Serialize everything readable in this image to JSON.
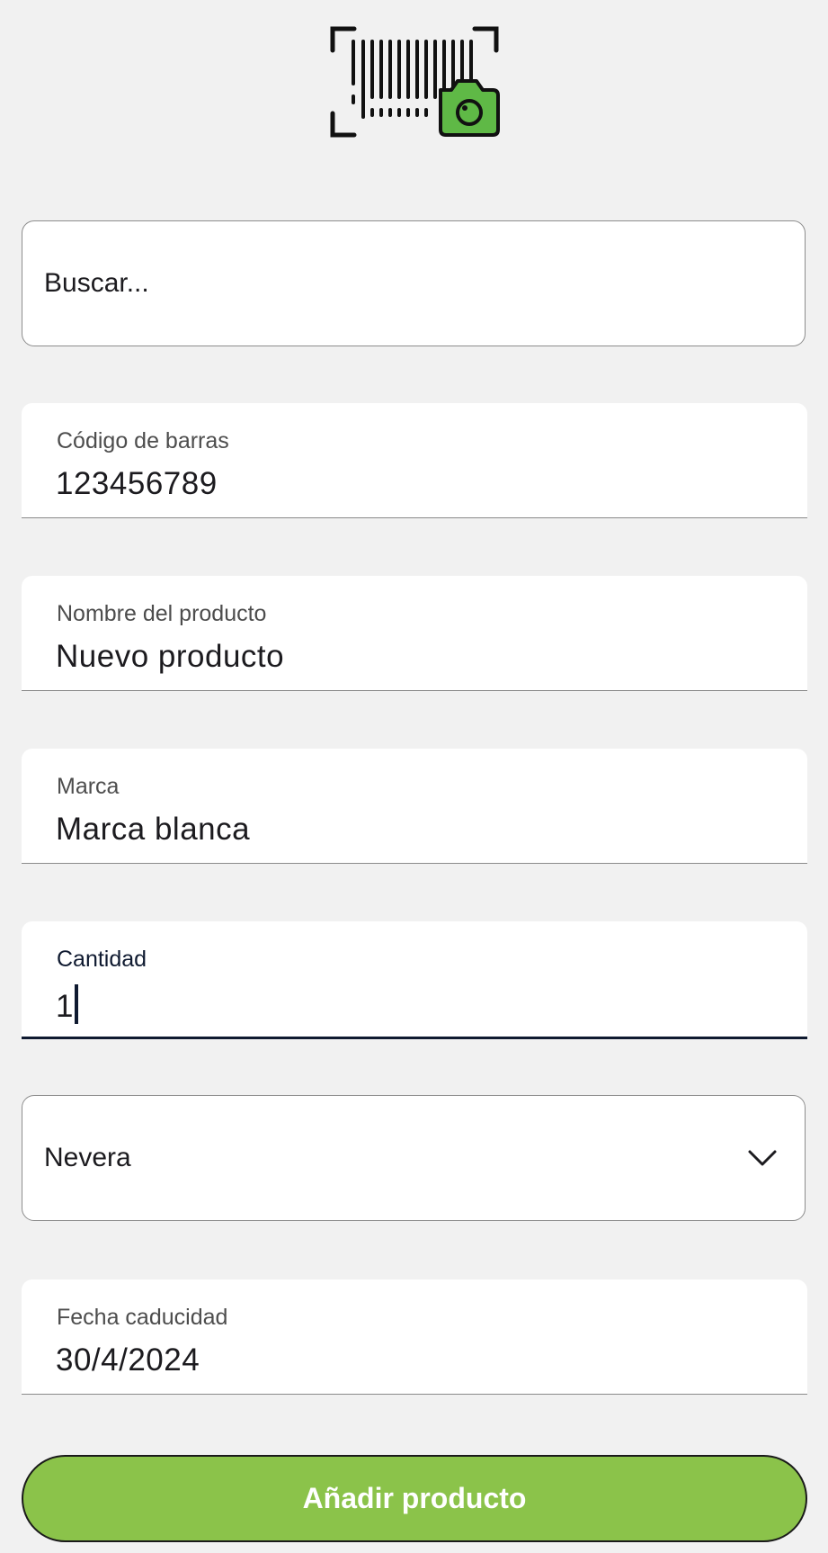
{
  "logo": {
    "icon": "barcode-scanner-camera-icon",
    "accent_color": "#5fb946"
  },
  "search": {
    "placeholder": "Buscar..."
  },
  "form": {
    "barcode": {
      "label": "Código de barras",
      "value": "123456789"
    },
    "product_name": {
      "label": "Nombre del producto",
      "value": "Nuevo producto"
    },
    "brand": {
      "label": "Marca",
      "value": "Marca blanca"
    },
    "quantity": {
      "label": "Cantidad",
      "value": "1"
    },
    "location": {
      "selected": "Nevera",
      "icon": "chevron-down-icon"
    },
    "expiry": {
      "label": "Fecha caducidad",
      "value": "30/4/2024"
    }
  },
  "actions": {
    "add_label": "Añadir producto",
    "button_color": "#8bc34a"
  }
}
